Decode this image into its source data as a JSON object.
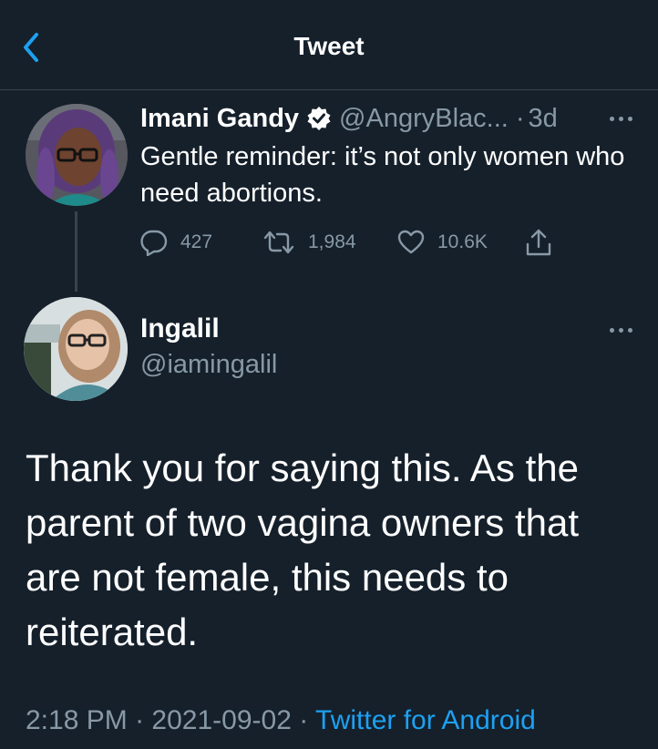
{
  "header": {
    "title": "Tweet"
  },
  "parent_tweet": {
    "name": "Imani Gandy",
    "handle": "@AngryBlac...",
    "separator": "·",
    "age": "3d",
    "text": "Gentle reminder: it’s not only women who need abortions.",
    "replies": "427",
    "retweets": "1,984",
    "likes": "10.6K"
  },
  "reply_tweet": {
    "name": "Ingalil",
    "handle": "@iamingalil",
    "text": "Thank you for saying this. As the parent of two vagina owners that are not female, this needs to reiterated.",
    "time": "2:18 PM",
    "separator": "·",
    "date": "2021-09-02",
    "source": "Twitter for Android"
  },
  "icons": {
    "back": "chevron-left-icon",
    "verified": "verified-badge-icon",
    "more": "more-horizontal-icon",
    "reply": "reply-icon",
    "retweet": "retweet-icon",
    "like": "heart-icon",
    "share": "share-icon"
  },
  "colors": {
    "background": "#15202b",
    "accent": "#1da1f2",
    "secondary_text": "#8899a6",
    "divider": "#38444d"
  }
}
